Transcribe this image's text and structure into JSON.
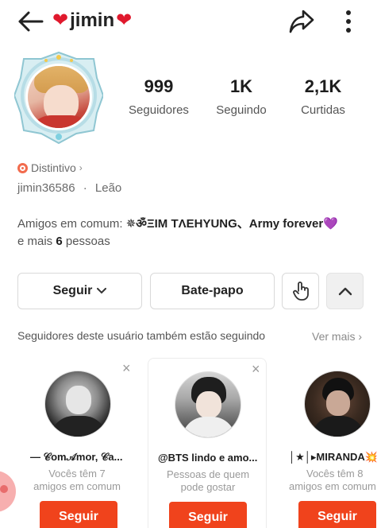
{
  "header": {
    "title": "jimin",
    "left_heart": "❤",
    "right_heart": "❤"
  },
  "stats": [
    {
      "value": "999",
      "label": "Seguidores"
    },
    {
      "value": "1K",
      "label": "Seguindo"
    },
    {
      "value": "2,1K",
      "label": "Curtidas"
    }
  ],
  "badge": {
    "label": "Distintivo"
  },
  "user": {
    "handle": "jimin36586",
    "separator": "·",
    "sign": "Leão"
  },
  "mutual": {
    "prefix": "Amigos em comum:",
    "names": "✵ॐΞIM TΛEHYUNG、Army forever💜",
    "suffix_start": "e mais",
    "count": "6",
    "suffix_end": "pessoas"
  },
  "actions": {
    "follow": "Seguir",
    "chat": "Bate-papo"
  },
  "suggestions": {
    "title": "Seguidores deste usuário também estão seguindo",
    "see_more": "Ver mais",
    "close_glyph": "×",
    "cards": [
      {
        "name": "— 𝒞om𝒜mor, 𝒞a...",
        "desc_line1": "Vocês têm 7",
        "desc_line2": "amigos em comum",
        "button": "Seguir"
      },
      {
        "name": "@BTS lindo e amo...",
        "desc_line1": "Pessoas de quem",
        "desc_line2": "pode gostar",
        "button": "Seguir"
      },
      {
        "name": "│★│▸MIRANDA💥",
        "desc_line1": "Vocês têm 8",
        "desc_line2": "amigos em comum",
        "button": "Seguir"
      }
    ]
  },
  "colors": {
    "accent": "#f0431c",
    "heart": "#e0192d",
    "badge": "#f26b4d"
  },
  "icons": {
    "back": "arrow-left-icon",
    "share": "share-arrow-icon",
    "more": "vertical-dots-icon",
    "chevron": "chevron-down-icon",
    "pointer": "hand-pointer-icon",
    "collapse": "chevron-up-icon"
  }
}
